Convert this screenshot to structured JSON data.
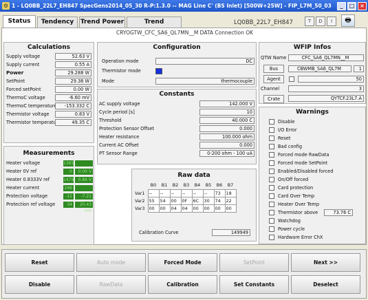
{
  "window": {
    "title": "1 - LQ0BB_22L7_EH847 SpecGens2014_05_30 R-P:1.3.0 -- MAG Line C' (BS Inlet) [500W+25W] - FIP_L7M_50_03",
    "app_icon": "gear-icon"
  },
  "tabs": [
    "Status",
    "Tendency",
    "Trend Power",
    "Trend ThCouple"
  ],
  "device_name": "LQ0BB_22L7_EH847",
  "top_buttons": [
    "T",
    "D",
    "I"
  ],
  "connection": "CRYOGTW_CFC_SA6_QL7MN__M DATA Connection OK",
  "calculations": {
    "title": "Calculations",
    "rows": [
      {
        "label": "Supply voltage",
        "value": "52.63 V"
      },
      {
        "label": "Supply current",
        "value": "0.55 A"
      },
      {
        "label": "Power",
        "value": "29.288 W"
      },
      {
        "label": "SetPoint",
        "value": "29.38 W"
      },
      {
        "label": "Forced setPoint",
        "value": "0.00 W"
      },
      {
        "label": "ThermoC voltage",
        "value": "-6.60 mV"
      },
      {
        "label": "ThermoC temperature",
        "value": "-153.332 C"
      },
      {
        "label": "Thermistor voltage",
        "value": "0.83 V"
      },
      {
        "label": "Thermistor temperature",
        "value": "49.35 C"
      }
    ]
  },
  "measurements": {
    "title": "Measurements",
    "rows": [
      {
        "label": "Heater voltage",
        "raw": "1365",
        "value": ""
      },
      {
        "label": "Heater 0V ref",
        "raw": "0",
        "value": "0.00 V"
      },
      {
        "label": "Heater 0.8333V ref",
        "raw": "1479",
        "value": "0.84 V"
      },
      {
        "label": "Heater current",
        "raw": "246",
        "value": ""
      },
      {
        "label": "Protection voltage",
        "raw": "-12",
        "value": "-7.21 mV"
      },
      {
        "label": "Protection ref voltage",
        "raw": "34",
        "value": "20.43 mV"
      }
    ]
  },
  "configuration": {
    "title": "Configuration",
    "operation_mode_label": "Operation mode",
    "operation_mode": "DC",
    "thermistor_mode_label": "Thermistor mode",
    "thermistor_color": "#1530e0",
    "mode_label": "Mode",
    "mode": "thermocouple"
  },
  "constants": {
    "title": "Constants",
    "rows": [
      {
        "label": "AC supply voltage",
        "value": "142.000 V"
      },
      {
        "label": "Cycle period [s]",
        "value": "10"
      },
      {
        "label": "Threshold",
        "value": "40.000 C"
      },
      {
        "label": "Protection Sensor Offset",
        "value": "0.000"
      },
      {
        "label": "Heater resistance",
        "value": "100.000 ohm"
      },
      {
        "label": "Current AC Offset",
        "value": "0.000"
      },
      {
        "label": "PT Sensor Range",
        "value": "0-200 ohm - 100 uA"
      }
    ]
  },
  "raw_data": {
    "title": "Raw data",
    "columns": [
      "B0",
      "B1",
      "B2",
      "B3",
      "B4",
      "B5",
      "B6",
      "B7"
    ],
    "rows": [
      {
        "name": "Var1",
        "cells": [
          "--",
          "--",
          "--",
          "--",
          "--",
          "--",
          "73",
          "18"
        ]
      },
      {
        "name": "Var2",
        "cells": [
          "55",
          "54",
          "00",
          "0F",
          "6C",
          "30",
          "74",
          "22"
        ]
      },
      {
        "name": "Var3",
        "cells": [
          "00",
          "00",
          "04",
          "04",
          "00",
          "00",
          "00",
          "00"
        ]
      }
    ],
    "calibration_label": "Calibration Curve",
    "calibration_value": "149949"
  },
  "wfip": {
    "title": "WFIP Infos",
    "qtw_label": "QTW Name",
    "qtw_name": "CFC_SA6_QL7MN__M",
    "bus_label": "Bus",
    "bus_value": "CBWMB_SA6_QL7M",
    "bus_num": "1",
    "agent_label": "Agent",
    "agent_value": "50",
    "channel_label": "Channel",
    "channel_value": "3",
    "crate_label": "Crate",
    "crate_value": "QYTCF.23L7.A"
  },
  "warnings": {
    "title": "Warnings",
    "items": [
      "Disable",
      "I/O Error",
      "Reset",
      "Bad config",
      "Forced mode RawData",
      "Forced mode SetPoint",
      "Enabled/Disabled forced",
      "On/Off forced",
      "Card protection",
      "Card Over Temp",
      "Heater Over Temp",
      "Thermistor above",
      "Watchdog",
      "Power cycle",
      "Hardware Error ChX"
    ],
    "thermistor_above_value": "73.76 C"
  },
  "bottom": {
    "row1": [
      {
        "label": "Reset",
        "enabled": true
      },
      {
        "label": "Auto mode",
        "enabled": false
      },
      {
        "label": "Forced Mode",
        "enabled": true
      },
      {
        "label": "SetPoint",
        "enabled": false
      },
      {
        "label": "Next >>",
        "enabled": true
      }
    ],
    "row2": [
      {
        "label": "Disable",
        "enabled": true
      },
      {
        "label": "RawData",
        "enabled": false
      },
      {
        "label": "Calibration",
        "enabled": true
      },
      {
        "label": "Set Constants",
        "enabled": true
      },
      {
        "label": "Deselect",
        "enabled": true
      }
    ]
  },
  "colors": {
    "titlebar": "#2a62d8",
    "green_value": "#2f8a22",
    "indicator_blue": "#1530e0"
  }
}
